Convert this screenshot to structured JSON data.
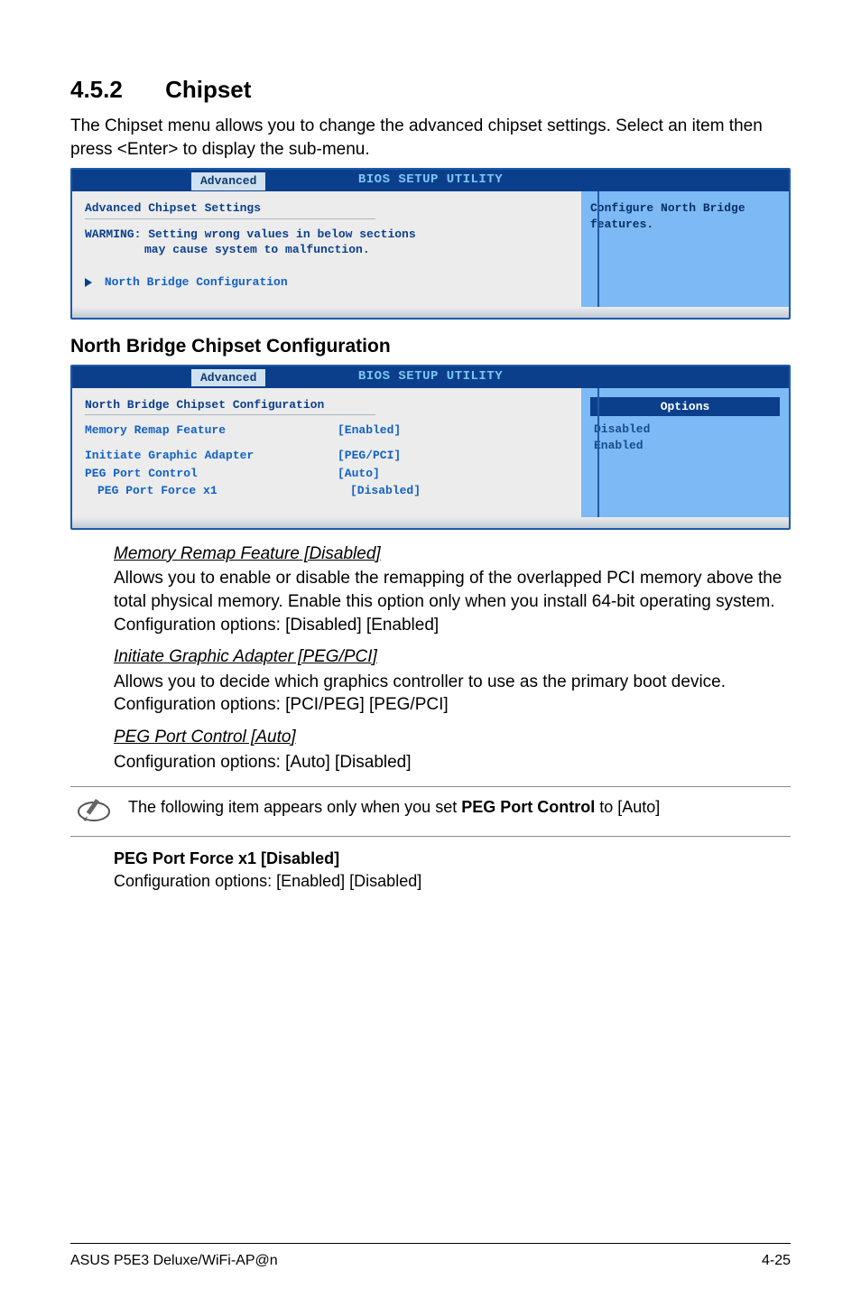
{
  "section": {
    "number": "4.5.2",
    "title": "Chipset"
  },
  "intro": "The Chipset menu allows you to change the advanced chipset settings. Select an item then press <Enter> to display the sub-menu.",
  "bios1": {
    "utility_title": "BIOS SETUP UTILITY",
    "tab": "Advanced",
    "heading": "Advanced Chipset Settings",
    "warning": "WARMING: Setting wrong values in below sections may cause system to malfunction.",
    "warning_line1": "WARMING: Setting wrong values in below sections",
    "warning_line2": "may cause system to malfunction.",
    "submenu": "North Bridge Configuration",
    "side_text": "Configure North Bridge features."
  },
  "sub_heading": "North Bridge Chipset Configuration",
  "bios2": {
    "utility_title": "BIOS SETUP UTILITY",
    "tab": "Advanced",
    "heading": "North Bridge Chipset Configuration",
    "rows": [
      {
        "label": "Memory Remap Feature",
        "value": "[Enabled]"
      },
      {
        "label": "Initiate Graphic Adapter",
        "value": "[PEG/PCI]"
      },
      {
        "label": "PEG Port Control",
        "value": "[Auto]"
      },
      {
        "label": "PEG Port Force x1",
        "value": "[Disabled]",
        "indent": true
      }
    ],
    "options_header": "Options",
    "options": [
      "Disabled",
      "Enabled"
    ]
  },
  "items": {
    "memory_remap": {
      "title": "Memory Remap Feature [Disabled]",
      "body": "Allows you to enable or disable the remapping of the overlapped PCI memory above the total physical memory. Enable this option only when you install 64-bit operating system. Configuration options: [Disabled] [Enabled]"
    },
    "init_graphic": {
      "title": "Initiate Graphic Adapter [PEG/PCI]",
      "body": "Allows you to decide which graphics controller to use as the primary boot device. Configuration options: [PCI/PEG] [PEG/PCI]"
    },
    "peg_control": {
      "title": "PEG Port Control [Auto]",
      "body": "Configuration options: [Auto] [Disabled]"
    }
  },
  "pen_note_prefix": "The following item appears only when you set ",
  "pen_note_bold": "PEG Port Control",
  "pen_note_suffix": " to [Auto]",
  "box_note": {
    "title": "PEG Port Force x1 [Disabled]",
    "body": "Configuration options: [Enabled] [Disabled]"
  },
  "footer": {
    "left": "ASUS P5E3 Deluxe/WiFi-AP@n",
    "right": "4-25"
  }
}
